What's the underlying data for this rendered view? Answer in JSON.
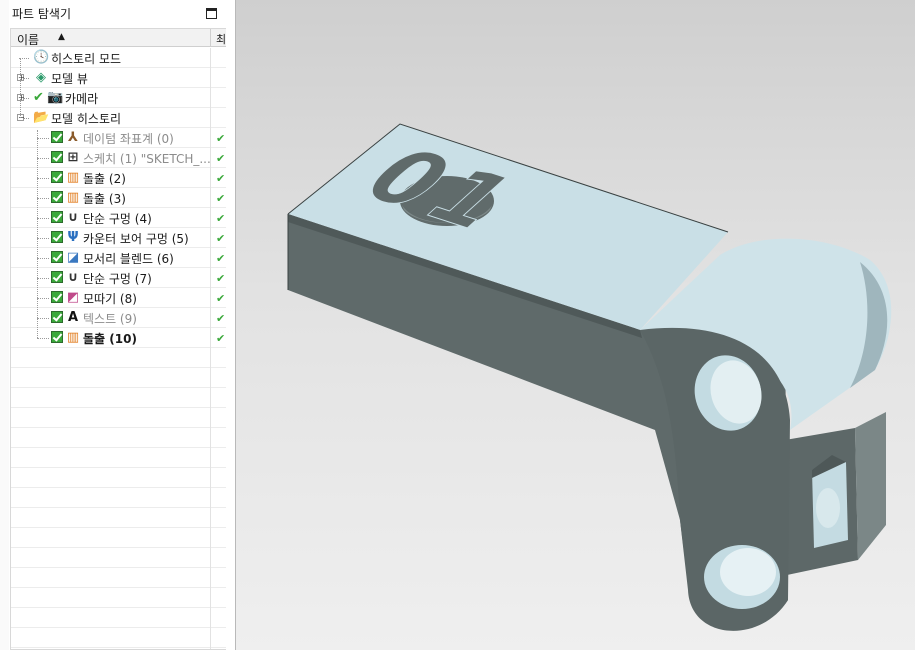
{
  "navigator": {
    "title": "파트 탐색기",
    "column_name": "이름",
    "column_two": "최"
  },
  "tree": [
    {
      "label": "히스토리 모드",
      "icon": "clock-icon",
      "style": "normal",
      "level": 0,
      "checked": false,
      "status": ""
    },
    {
      "label": "모델 뷰",
      "icon": "model-views-icon",
      "style": "normal",
      "level": 0,
      "checked": false,
      "status": "",
      "expander": "+"
    },
    {
      "label": "카메라",
      "icon": "camera-icon",
      "style": "normal",
      "level": 0,
      "checked": false,
      "status": "",
      "expander": "+"
    },
    {
      "label": "모델 히스토리",
      "icon": "folder-open-icon",
      "style": "normal",
      "level": 0,
      "checked": false,
      "status": "",
      "expander": "−"
    },
    {
      "label": "데이텀 좌표계 (0)",
      "icon": "datum-csys-icon",
      "style": "grey",
      "level": 1,
      "checked": true,
      "status": "✔"
    },
    {
      "label": "스케치 (1) \"SKETCH_...",
      "icon": "sketch-icon",
      "style": "grey",
      "level": 1,
      "checked": true,
      "status": "✔"
    },
    {
      "label": "돌출 (2)",
      "icon": "extrude-icon",
      "style": "normal",
      "level": 1,
      "checked": true,
      "status": "✔"
    },
    {
      "label": "돌출 (3)",
      "icon": "extrude-icon",
      "style": "normal",
      "level": 1,
      "checked": true,
      "status": "✔"
    },
    {
      "label": "단순 구멍 (4)",
      "icon": "simple-hole-icon",
      "style": "normal",
      "level": 1,
      "checked": true,
      "status": "✔"
    },
    {
      "label": "카운터 보어 구멍 (5)",
      "icon": "counterbore-hole-icon",
      "style": "normal",
      "level": 1,
      "checked": true,
      "status": "✔"
    },
    {
      "label": "모서리 블렌드 (6)",
      "icon": "edge-blend-icon",
      "style": "normal",
      "level": 1,
      "checked": true,
      "status": "✔"
    },
    {
      "label": "단순 구멍 (7)",
      "icon": "simple-hole-icon",
      "style": "normal",
      "level": 1,
      "checked": true,
      "status": "✔"
    },
    {
      "label": "모따기 (8)",
      "icon": "chamfer-icon",
      "style": "normal",
      "level": 1,
      "checked": true,
      "status": "✔"
    },
    {
      "label": "텍스트 (9)",
      "icon": "text-icon",
      "style": "grey",
      "level": 1,
      "checked": true,
      "status": "✔"
    },
    {
      "label": "돌출 (10)",
      "icon": "extrude-icon",
      "style": "bold",
      "level": 1,
      "checked": true,
      "status": "✔"
    }
  ],
  "model": {
    "engraved_text": "01"
  },
  "colors": {
    "part_top": "#c9dfe6",
    "part_side": "#5f6a6a",
    "check_green": "#3aa83a"
  }
}
